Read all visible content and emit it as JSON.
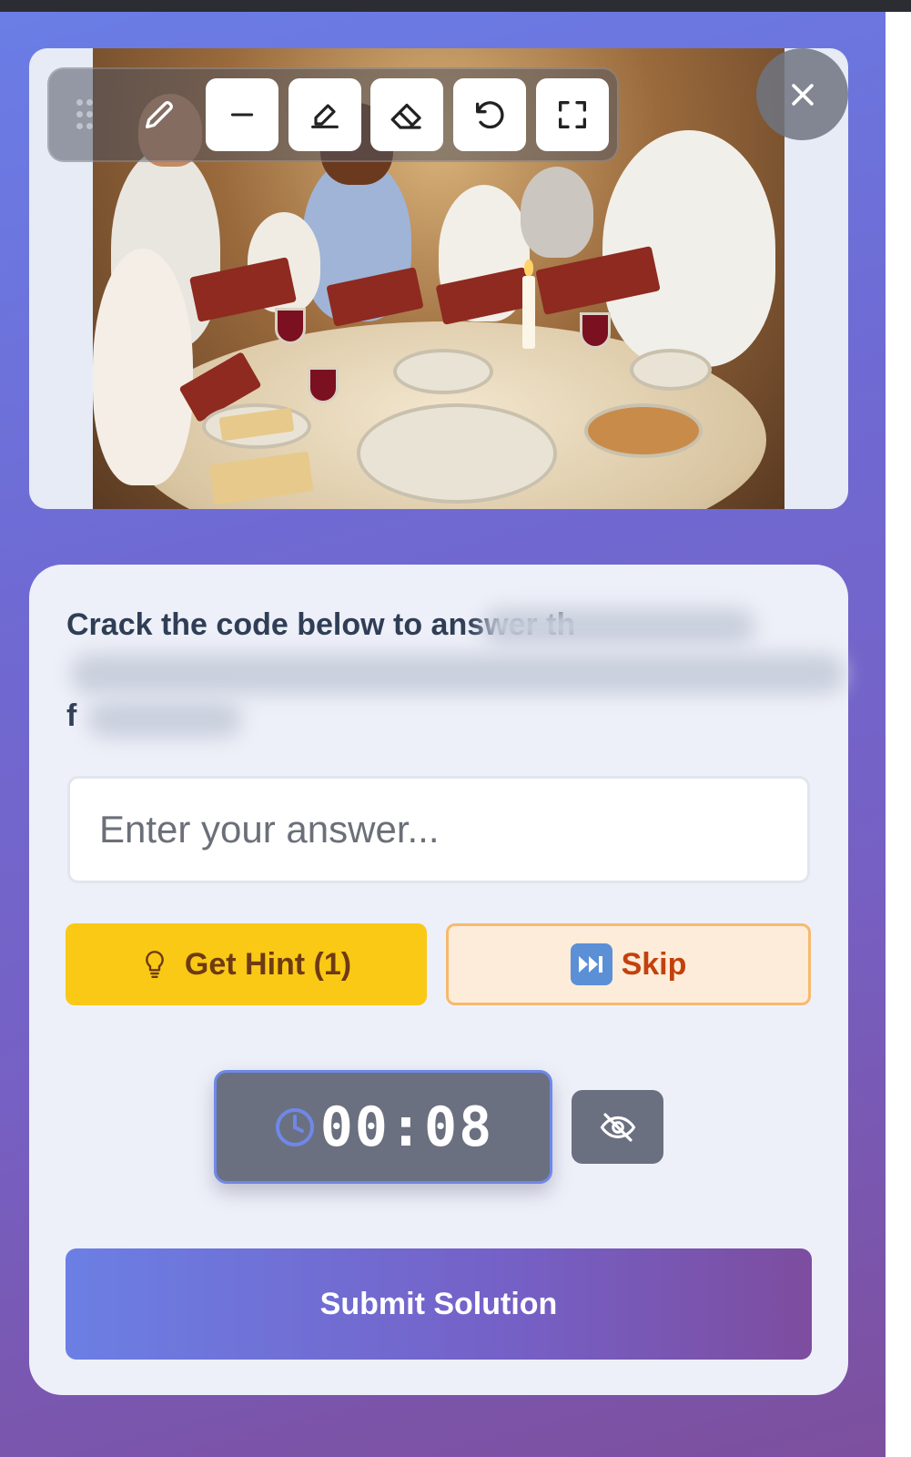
{
  "colors": {
    "accent": "#6b7fe4",
    "hint_button": "#f9c916",
    "skip_button_bg": "#fdecd9",
    "skip_text": "#c2410c",
    "timer_bg": "#6b7080"
  },
  "toolbar": {
    "tools": [
      {
        "name": "drag-handle",
        "icon": "grip-dots-icon"
      },
      {
        "name": "pencil",
        "icon": "pencil-icon"
      },
      {
        "name": "line",
        "icon": "minus-icon"
      },
      {
        "name": "highlighter",
        "icon": "highlighter-icon"
      },
      {
        "name": "eraser",
        "icon": "eraser-icon"
      },
      {
        "name": "undo",
        "icon": "undo-icon"
      },
      {
        "name": "fullscreen",
        "icon": "fullscreen-icon"
      }
    ],
    "close_icon": "close-icon"
  },
  "quiz": {
    "question_visible": "Crack the code below to answer th",
    "question_line3": "f",
    "answer_placeholder": "Enter your answer...",
    "hint_label": "Get Hint (1)",
    "skip_label": "Skip",
    "timer_value": "00:08",
    "submit_label": "Submit Solution"
  }
}
